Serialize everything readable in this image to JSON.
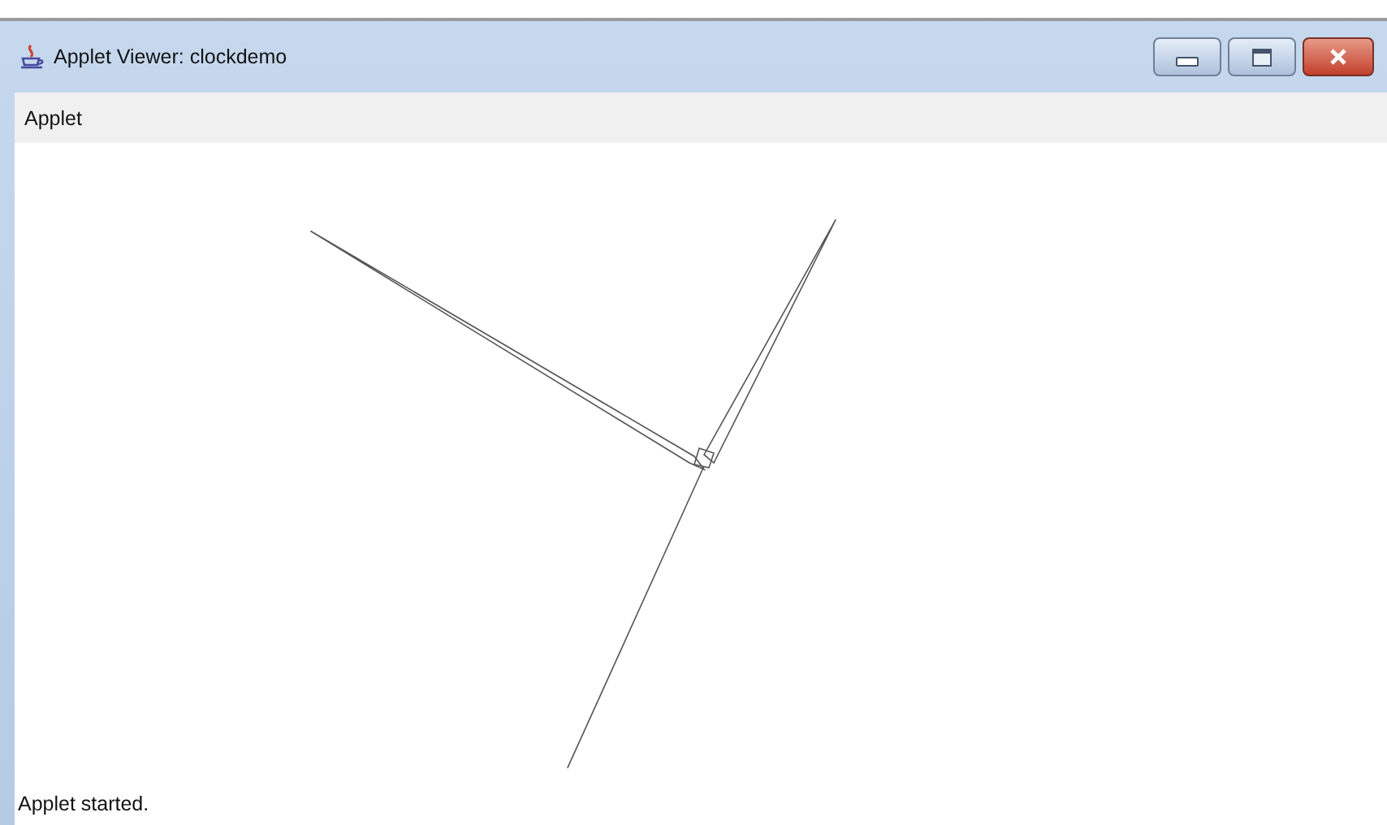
{
  "window": {
    "title": "Applet Viewer: clockdemo"
  },
  "menu_bar": {
    "items": [
      {
        "label": "Applet"
      }
    ]
  },
  "status_bar": {
    "text": "Applet started."
  }
}
